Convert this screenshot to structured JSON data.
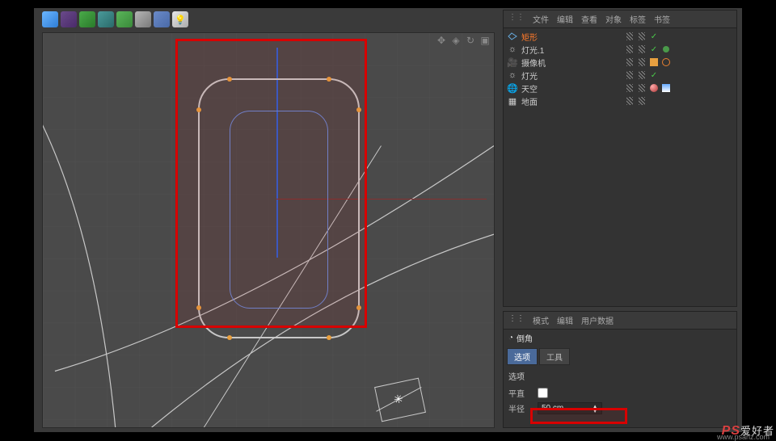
{
  "toolbar": {
    "items": [
      "cube",
      "pen",
      "deformer",
      "array",
      "generator",
      "camera",
      "grid",
      "light"
    ]
  },
  "viewport": {
    "icons": [
      "move",
      "rotate",
      "zoom",
      "frame"
    ]
  },
  "colors": {
    "highlight": "#d80000",
    "selected": "#ff7a2a",
    "axis_x": "#883030",
    "axis_y": "#3060d0"
  },
  "object_panel": {
    "menu": [
      "文件",
      "编辑",
      "查看",
      "对象",
      "标签",
      "书签"
    ],
    "items": [
      {
        "icon": "rect",
        "name": "矩形",
        "selected": true,
        "tags": [
          "vis",
          "vis",
          "check"
        ]
      },
      {
        "icon": "light",
        "name": "灯光.1",
        "selected": false,
        "tags": [
          "vis",
          "vis",
          "check",
          "sky"
        ]
      },
      {
        "icon": "camera",
        "name": "摄像机",
        "selected": false,
        "tags": [
          "vis",
          "vis",
          "cam",
          "target"
        ]
      },
      {
        "icon": "light",
        "name": "灯光",
        "selected": false,
        "tags": [
          "vis",
          "vis",
          "check"
        ]
      },
      {
        "icon": "sky",
        "name": "天空",
        "selected": false,
        "tags": [
          "vis",
          "vis",
          "phong",
          "sky"
        ]
      },
      {
        "icon": "floor",
        "name": "地面",
        "selected": false,
        "tags": [
          "vis",
          "vis"
        ]
      }
    ]
  },
  "attr_panel": {
    "menu": [
      "模式",
      "编辑",
      "用户数据"
    ],
    "title": "倒角",
    "tabs": [
      {
        "label": "选项",
        "active": true
      },
      {
        "label": "工具",
        "active": false
      }
    ],
    "section": "选项",
    "flat_label": "平直",
    "radius_label": "半径",
    "radius_value": "50 cm"
  },
  "watermark": {
    "brand": "PS",
    "text": "爱好者",
    "url": "www.psahz.com"
  }
}
